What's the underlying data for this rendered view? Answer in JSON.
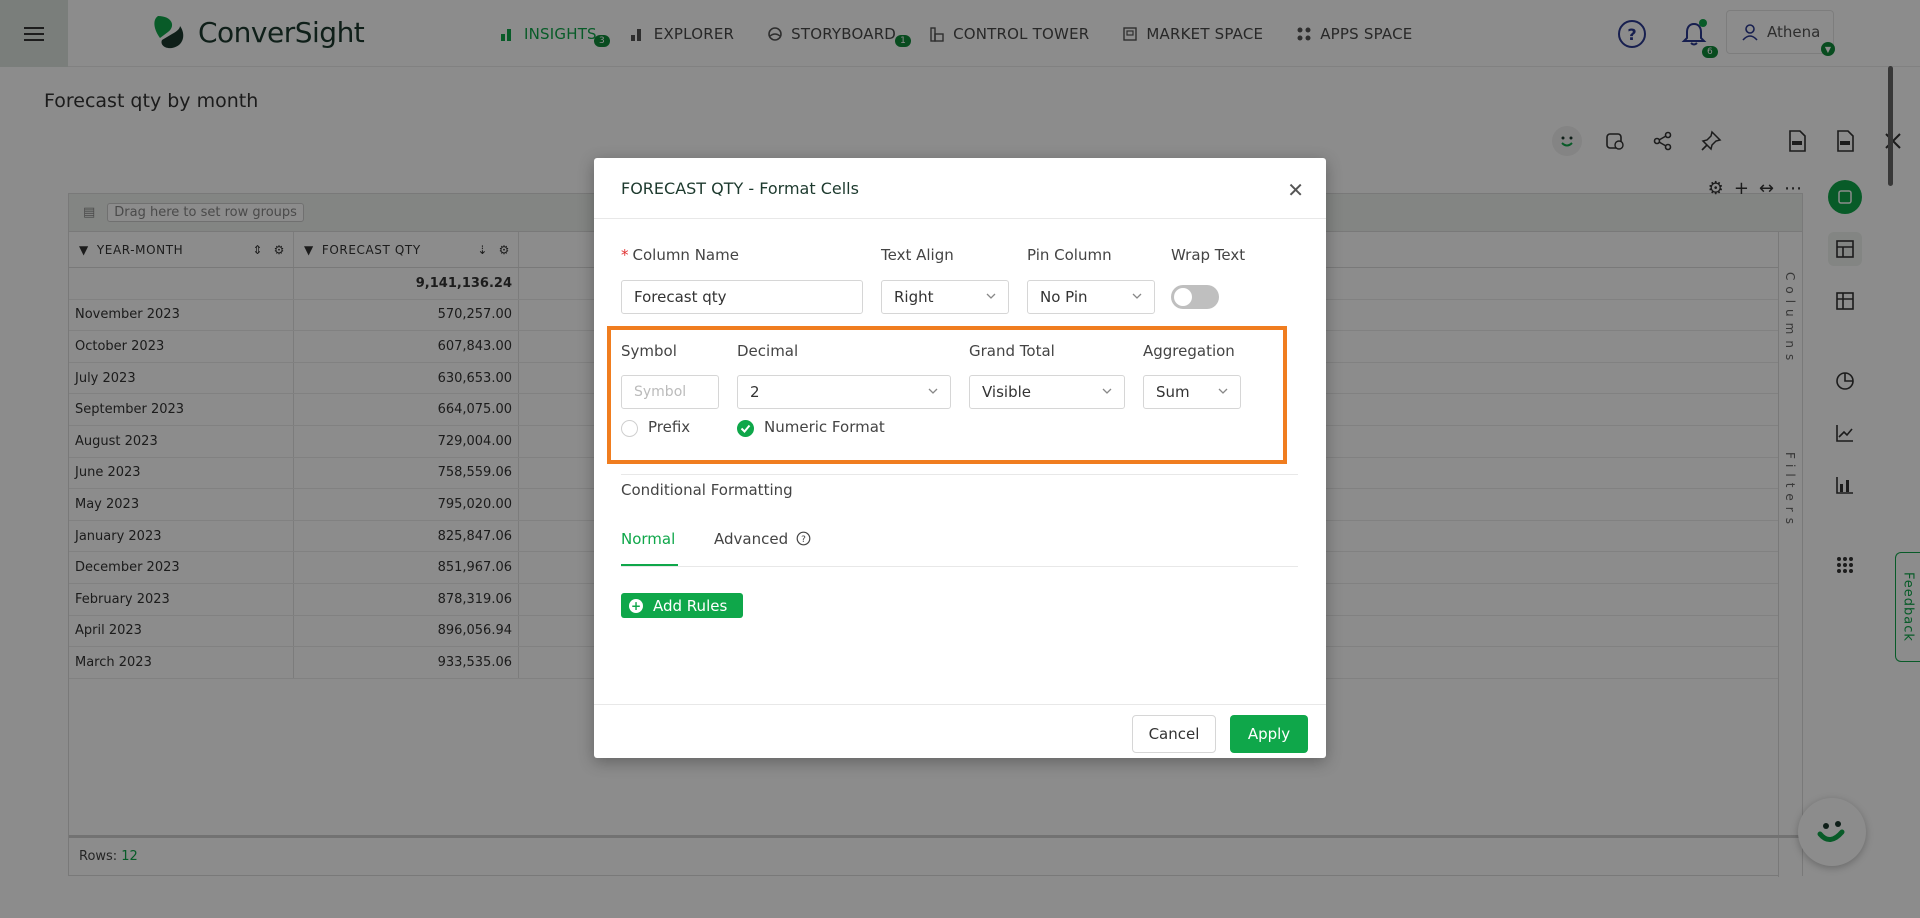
{
  "nav": {
    "brand": "ConverSight",
    "items": [
      {
        "label": "INSIGHTS",
        "badge": "3",
        "icon": "bar-chart-icon"
      },
      {
        "label": "EXPLORER",
        "icon": "explorer-icon"
      },
      {
        "label": "STORYBOARD",
        "badge": "1",
        "icon": "storyboard-icon"
      },
      {
        "label": "CONTROL TOWER",
        "icon": "control-tower-icon"
      },
      {
        "label": "MARKET SPACE",
        "icon": "market-space-icon"
      },
      {
        "label": "APPS SPACE",
        "icon": "apps-space-icon"
      }
    ],
    "notifications": "6",
    "user": "Athena",
    "accent": "#0fa74a"
  },
  "page": {
    "title": "Forecast qty by month"
  },
  "grid": {
    "drag_placeholder": "Drag here to set row groups",
    "columns": [
      "YEAR-MONTH",
      "FORECAST QTY"
    ],
    "total": "9,141,136.24",
    "rows": [
      [
        "November 2023",
        "570,257.00"
      ],
      [
        "October 2023",
        "607,843.00"
      ],
      [
        "July 2023",
        "630,653.00"
      ],
      [
        "September 2023",
        "664,075.00"
      ],
      [
        "August 2023",
        "729,004.00"
      ],
      [
        "June 2023",
        "758,559.06"
      ],
      [
        "May 2023",
        "795,020.00"
      ],
      [
        "January 2023",
        "825,847.06"
      ],
      [
        "December 2023",
        "851,967.06"
      ],
      [
        "February 2023",
        "878,319.06"
      ],
      [
        "April 2023",
        "896,056.94"
      ],
      [
        "March 2023",
        "933,535.06"
      ]
    ],
    "side_columns": "Columns",
    "side_filters": "Filters",
    "rows_label": "Rows:",
    "rows_count": "12"
  },
  "feedback": "Feedback",
  "modal": {
    "title": "FORECAST QTY - Format Cells",
    "column_name_label": "Column Name",
    "column_name_value": "Forecast qty",
    "text_align_label": "Text Align",
    "text_align_value": "Right",
    "pin_column_label": "Pin Column",
    "pin_column_value": "No Pin",
    "wrap_text_label": "Wrap Text",
    "wrap_text_on": false,
    "symbol_label": "Symbol",
    "symbol_placeholder": "Symbol",
    "decimal_label": "Decimal",
    "decimal_value": "2",
    "grand_total_label": "Grand Total",
    "grand_total_value": "Visible",
    "aggregation_label": "Aggregation",
    "aggregation_value": "Sum",
    "prefix_label": "Prefix",
    "prefix_checked": false,
    "numeric_format_label": "Numeric Format",
    "numeric_format_checked": true,
    "conditional_formatting_label": "Conditional Formatting",
    "tab_normal": "Normal",
    "tab_advanced": "Advanced",
    "add_rules_label": "Add Rules",
    "cancel_label": "Cancel",
    "apply_label": "Apply",
    "highlight_color": "#f07d1f"
  }
}
